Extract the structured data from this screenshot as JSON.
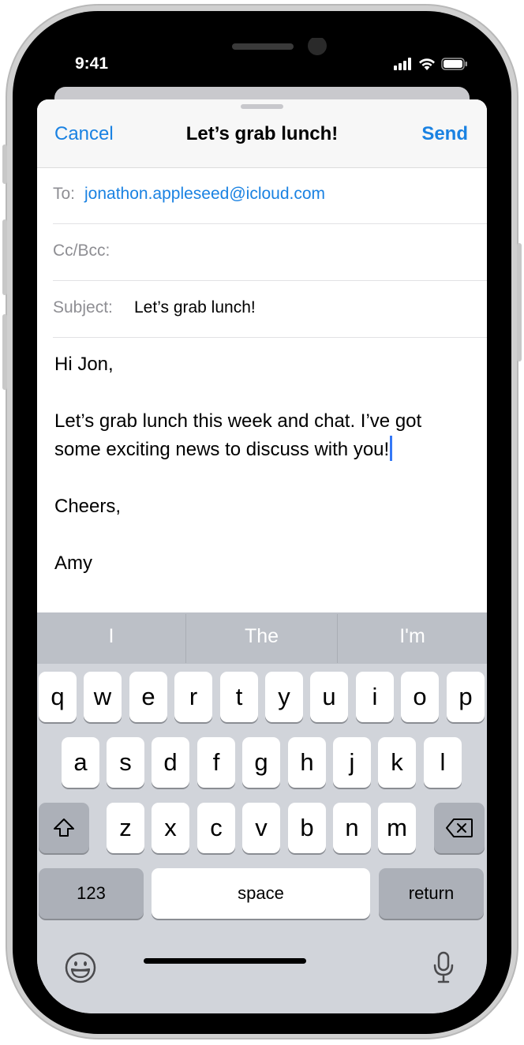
{
  "status": {
    "time": "9:41"
  },
  "nav": {
    "cancel": "Cancel",
    "title": "Let’s grab lunch!",
    "send": "Send"
  },
  "fields": {
    "to_label": "To:",
    "to_value": "jonathon.appleseed@icloud.com",
    "cc_label": "Cc/Bcc:",
    "subject_label": "Subject:",
    "subject_value": "Let’s grab lunch!"
  },
  "body": {
    "greeting": "Hi Jon,",
    "line1": "Let’s grab lunch this week and chat. I’ve got",
    "line2": "some exciting news to discuss with you!",
    "signoff": "Cheers,",
    "name": "Amy"
  },
  "predictions": [
    "I",
    "The",
    "I'm"
  ],
  "keyboard": {
    "row1": [
      "q",
      "w",
      "e",
      "r",
      "t",
      "y",
      "u",
      "i",
      "o",
      "p"
    ],
    "row2": [
      "a",
      "s",
      "d",
      "f",
      "g",
      "h",
      "j",
      "k",
      "l"
    ],
    "row3": [
      "z",
      "x",
      "c",
      "v",
      "b",
      "n",
      "m"
    ],
    "numbers": "123",
    "space": "space",
    "return": "return"
  },
  "icons": {
    "shift": "shift-arrow-icon",
    "delete": "backspace-icon",
    "emoji": "emoji-face-icon",
    "mic": "microphone-icon"
  },
  "colors": {
    "accent": "#1a82e2",
    "cursor": "#3478f6",
    "keyboard_bg": "#d1d4da"
  }
}
